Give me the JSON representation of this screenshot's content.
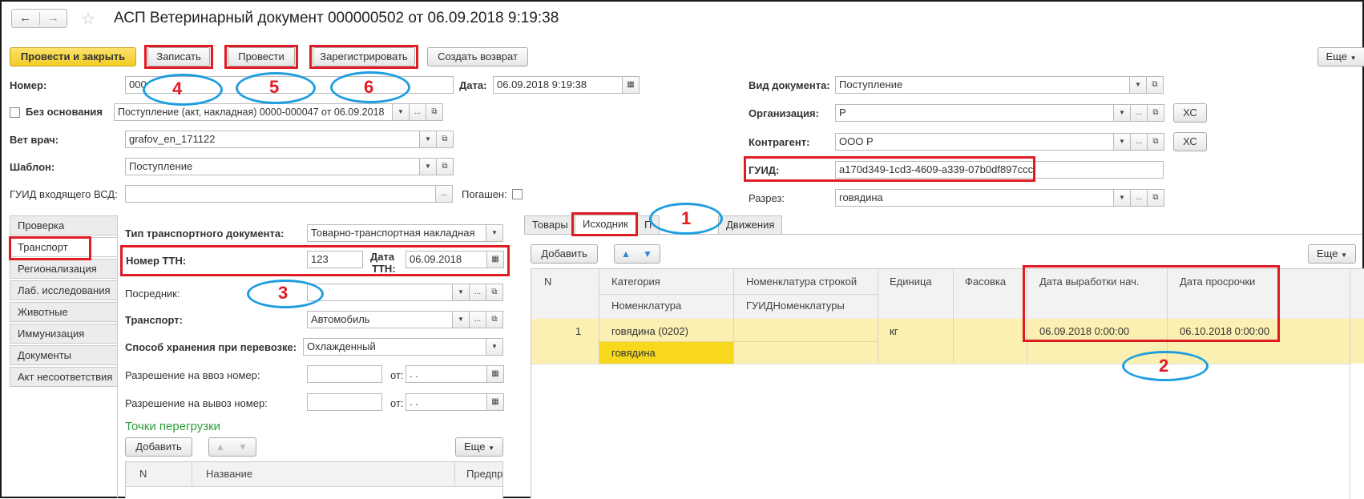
{
  "window": {
    "title": "АСП Ветеринарный документ 000000502 от 06.09.2018 9:19:38"
  },
  "toolbar": {
    "post_close": "Провести и закрыть",
    "save": "Записать",
    "post": "Провести",
    "register": "Зарегистрировать",
    "create_return": "Создать возврат",
    "more": "Еще"
  },
  "header": {
    "number_label": "Номер:",
    "number_value": "000",
    "date_label": "Дата:",
    "date_value": "06.09.2018  9:19:38",
    "no_basis_label": "Без основания",
    "basis_value": "Поступление (акт, накладная) 0000-000047 от 06.09.2018",
    "vet_label": "Вет врач:",
    "vet_value": "grafov_en_171122",
    "template_label": "Шаблон:",
    "template_value": "Поступление",
    "incoming_guid_label": "ГУИД входящего ВСД:",
    "paid_label": "Погашен:",
    "doc_type_label": "Вид документа:",
    "doc_type_value": "Поступление",
    "org_label": "Организация:",
    "org_value": "Р",
    "contractor_label": "Контрагент:",
    "contractor_value": "ООО Р",
    "xc_label": "ХС",
    "guid_label": "ГУИД:",
    "guid_value": "a170d349-1cd3-4609-a339-07b0df897ccc",
    "cut_label": "Разрез:",
    "cut_value": "говядина"
  },
  "left_tabs": [
    "Проверка",
    "Транспорт",
    "Регионализация",
    "Лаб. исследования",
    "Животные",
    "Иммунизация",
    "Документы",
    "Акт несоответствия"
  ],
  "transport": {
    "doc_type_label": "Тип транспортного документа:",
    "doc_type_value": "Товарно-транспортная накладная",
    "ttn_label": "Номер ТТН:",
    "ttn_value": "123",
    "ttn_date_label_1": "Дата",
    "ttn_date_label_2": "ТТН:",
    "ttn_date_value": "06.09.2018",
    "intermediary_label": "Посредник:",
    "transport_label": "Транспорт:",
    "transport_value": "Автомобиль",
    "storage_label": "Способ хранения при перевозке:",
    "storage_value": "Охлажденный",
    "import_label": "Разрешение на ввоз номер:",
    "export_label": "Разрешение на вывоз номер:",
    "from_label": "от:",
    "empty_date": " .  .",
    "transshipment_title": "Точки перегрузки",
    "add_label": "Добавить",
    "more_label": "Еще",
    "col_n": "N",
    "col_name": "Название",
    "col_pred": "Предпр"
  },
  "right_tabs": [
    "Товары",
    "Исходник",
    "П",
    "Движения"
  ],
  "goods": {
    "add_label": "Добавить",
    "more_label": "Еще",
    "headers": {
      "n": "N",
      "category": "Категория",
      "nomenclature": "Номенклатура",
      "nom_string": "Номенклатура строкой",
      "guid_nom": "ГУИДНоменклатуры",
      "unit": "Единица",
      "packing": "Фасовка",
      "prod_date": "Дата выработки нач.",
      "expiry": "Дата просрочки"
    },
    "rows": [
      {
        "n": "1",
        "category": "говядина (0202)",
        "nomenclature": "говядина",
        "unit": "кг",
        "prod_date": "06.09.2018 0:00:00",
        "expiry": "06.10.2018 0:00:00"
      }
    ]
  },
  "annotations": [
    "1",
    "2",
    "3",
    "4",
    "5",
    "6"
  ],
  "colors": {
    "annotation_red": "#e01b24",
    "annotation_blue": "#1e9ee0",
    "primary_button": "#f6d94a",
    "row_highlight": "#fbf0b2",
    "row_selected": "#f7d81d",
    "section_title": "#2d9e3a"
  }
}
